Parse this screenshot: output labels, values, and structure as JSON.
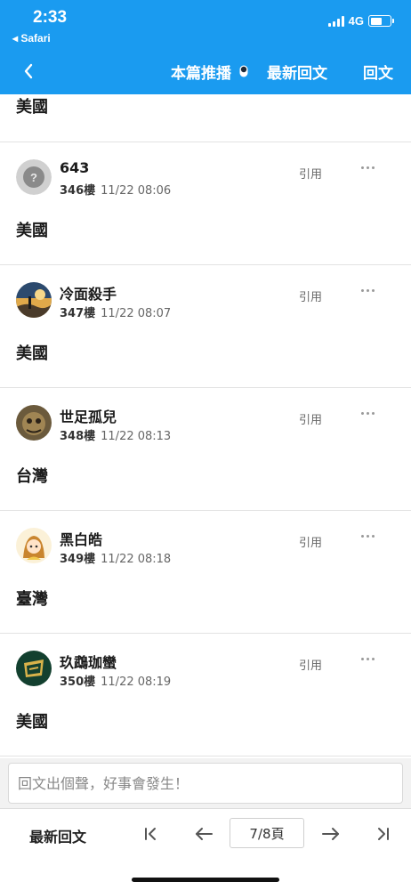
{
  "status_bar": {
    "time": "2:33",
    "back_app": "◂ Safari",
    "network": "4G"
  },
  "header": {
    "push_label": "本篇推播",
    "latest_label": "最新回文",
    "reply_label": "回文"
  },
  "partial_post": {
    "content": "美國"
  },
  "posts": [
    {
      "username": "643",
      "floor": "346樓",
      "time": "11/22 08:06",
      "quote": "引用",
      "content": "美國"
    },
    {
      "username": "冷面殺手",
      "floor": "347樓",
      "time": "11/22 08:07",
      "quote": "引用",
      "content": "美國"
    },
    {
      "username": "世足孤兒",
      "floor": "348樓",
      "time": "11/22 08:13",
      "quote": "引用",
      "content": "台灣"
    },
    {
      "username": "黑白皓",
      "floor": "349樓",
      "time": "11/22 08:18",
      "quote": "引用",
      "content": "臺灣"
    },
    {
      "username": "玖鵡珈蠻",
      "floor": "350樓",
      "time": "11/22 08:19",
      "quote": "引用",
      "content": "美國"
    }
  ],
  "reply_box": {
    "placeholder": "回文出個聲，好事會發生！"
  },
  "bottom_bar": {
    "latest_label": "最新回文",
    "page_indicator": "7/8頁"
  },
  "colors": {
    "header_bg": "#1a9bf0",
    "text": "#1b1b1b",
    "divider": "#e2e2e2"
  },
  "icons": [
    "back-chevron-icon",
    "push-toggle-icon",
    "more-dots-icon",
    "first-page-icon",
    "prev-page-icon",
    "next-page-icon",
    "last-page-icon"
  ]
}
